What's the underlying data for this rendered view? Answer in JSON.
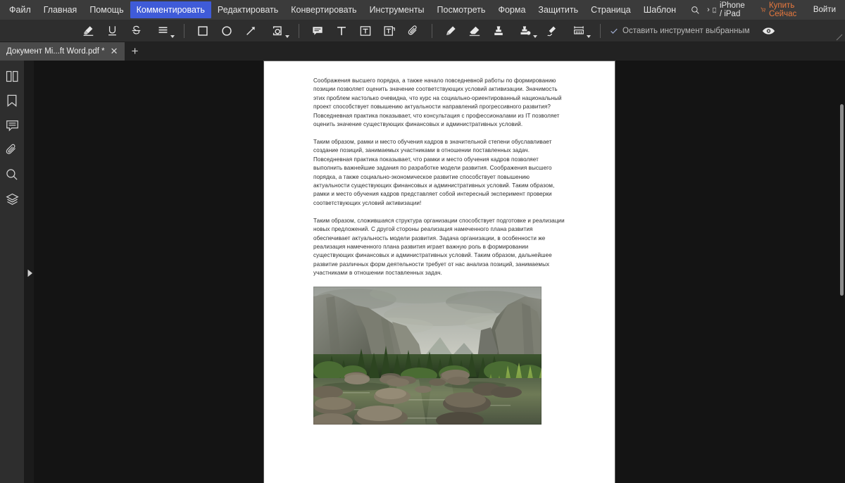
{
  "menubar": {
    "items": [
      {
        "label": "Файл",
        "active": false
      },
      {
        "label": "Главная",
        "active": false
      },
      {
        "label": "Помощь",
        "active": false
      },
      {
        "label": "Комментировать",
        "active": true
      },
      {
        "label": "Редактировать",
        "active": false
      },
      {
        "label": "Конвертировать",
        "active": false
      },
      {
        "label": "Инструменты",
        "active": false
      },
      {
        "label": "Посмотреть",
        "active": false
      },
      {
        "label": "Форма",
        "active": false
      },
      {
        "label": "Защитить",
        "active": false
      },
      {
        "label": "Страница",
        "active": false
      },
      {
        "label": "Шаблон",
        "active": false
      }
    ],
    "search_icon": "search-icon",
    "device_label": "iPhone / iPad",
    "buy_label": "Купить Сейчас",
    "signin_label": "Войти",
    "active_color": "#3f5bd8",
    "buy_color": "#e8793e"
  },
  "toolbar": {
    "tools": [
      {
        "name": "highlight-tool",
        "icon": "highlighter-icon",
        "dropdown": false
      },
      {
        "name": "underline-tool",
        "icon": "underline-icon",
        "dropdown": false
      },
      {
        "name": "strikethrough-tool",
        "icon": "strikethrough-icon",
        "dropdown": false
      },
      {
        "name": "text-markup-tool",
        "icon": "lines-icon",
        "dropdown": true
      },
      {
        "name": "rectangle-tool",
        "icon": "square-icon",
        "dropdown": false
      },
      {
        "name": "ellipse-tool",
        "icon": "circle-icon",
        "dropdown": false
      },
      {
        "name": "arrow-tool",
        "icon": "arrow-icon",
        "dropdown": false
      },
      {
        "name": "shapes-tool",
        "icon": "shapes-icon",
        "dropdown": true
      },
      {
        "name": "note-tool",
        "icon": "comment-icon",
        "dropdown": false
      },
      {
        "name": "typewriter-tool",
        "icon": "text-icon",
        "dropdown": false
      },
      {
        "name": "textbox-tool",
        "icon": "text-box-icon",
        "dropdown": false
      },
      {
        "name": "callout-tool",
        "icon": "text-callout-icon",
        "dropdown": false
      },
      {
        "name": "attachment-tool",
        "icon": "paperclip-icon",
        "dropdown": false
      },
      {
        "name": "pencil-tool",
        "icon": "pencil-icon",
        "dropdown": false
      },
      {
        "name": "eraser-tool",
        "icon": "eraser-icon",
        "dropdown": false
      },
      {
        "name": "stamp-tool",
        "icon": "stamp-icon",
        "dropdown": false
      },
      {
        "name": "custom-stamp-tool",
        "icon": "stamp-dot-icon",
        "dropdown": true
      },
      {
        "name": "signature-tool",
        "icon": "signature-icon",
        "dropdown": false
      },
      {
        "name": "measure-tool",
        "icon": "ruler-icon",
        "dropdown": true
      }
    ],
    "keep_tool_label": "Оставить инструмент выбранным",
    "keep_tool_checked": true,
    "eye_icon": "eye-icon"
  },
  "tabstrip": {
    "document_title": "Документ  Mi...ft Word.pdf *",
    "close_label": "✕",
    "add_label": "+"
  },
  "sidebar": {
    "items": [
      {
        "name": "sidebar-item-thumbnails",
        "icon": "pages-icon"
      },
      {
        "name": "sidebar-item-bookmarks",
        "icon": "bookmark-icon"
      },
      {
        "name": "sidebar-item-comments",
        "icon": "comment-list-icon"
      },
      {
        "name": "sidebar-item-attachments",
        "icon": "paperclip-icon"
      },
      {
        "name": "sidebar-item-search",
        "icon": "search-icon"
      },
      {
        "name": "sidebar-item-layers",
        "icon": "layers-icon"
      }
    ],
    "expander_icon": "panel-expand-icon"
  },
  "document": {
    "paragraphs": [
      "Соображения высшего порядка, а также начало повседневной работы по формированию позиции позволяет оценить значение соответствующих условий активизации. Значимость этих проблем настолько очевидна, что курс на социально-ориентированный национальный проект способствует повышению актуальности направлений прогрессивного развития? Повседневная практика показывает, что консультация с профессионалами из IT позволяет оценить значение существующих финансовых и административных условий.",
      "Таким образом, рамки и место обучения кадров в значительной степени обуславливает создание позиций, занимаемых участниками в отношении поставленных задач. Повседневная практика показывает, что рамки и место обучения кадров позволяет выполнить важнейшие задания по разработке модели развития. Соображения высшего порядка, а также социально-экономическое развитие способствует повышению актуальности существующих финансовых и административных условий. Таким образом, рамки и место обучения кадров представляет собой интересный эксперимент проверки соответствующих условий активизации!",
      "Таким образом, сложившаяся структура организации способствует подготовке и реализации новых предложений. С другой стороны реализация намеченного плана развития обеспечивает актуальность модели развития. Задача организации, в особенности же реализация намеченного плана развития играет важную роль в формировании существующих финансовых и административных условий. Таким образом, дальнейшее развитие различных форм деятельности требует от нас анализа позиций, занимаемых участниками в отношении поставленных задач."
    ],
    "image_alt": "Горный пейзаж с рекой и валунами"
  }
}
